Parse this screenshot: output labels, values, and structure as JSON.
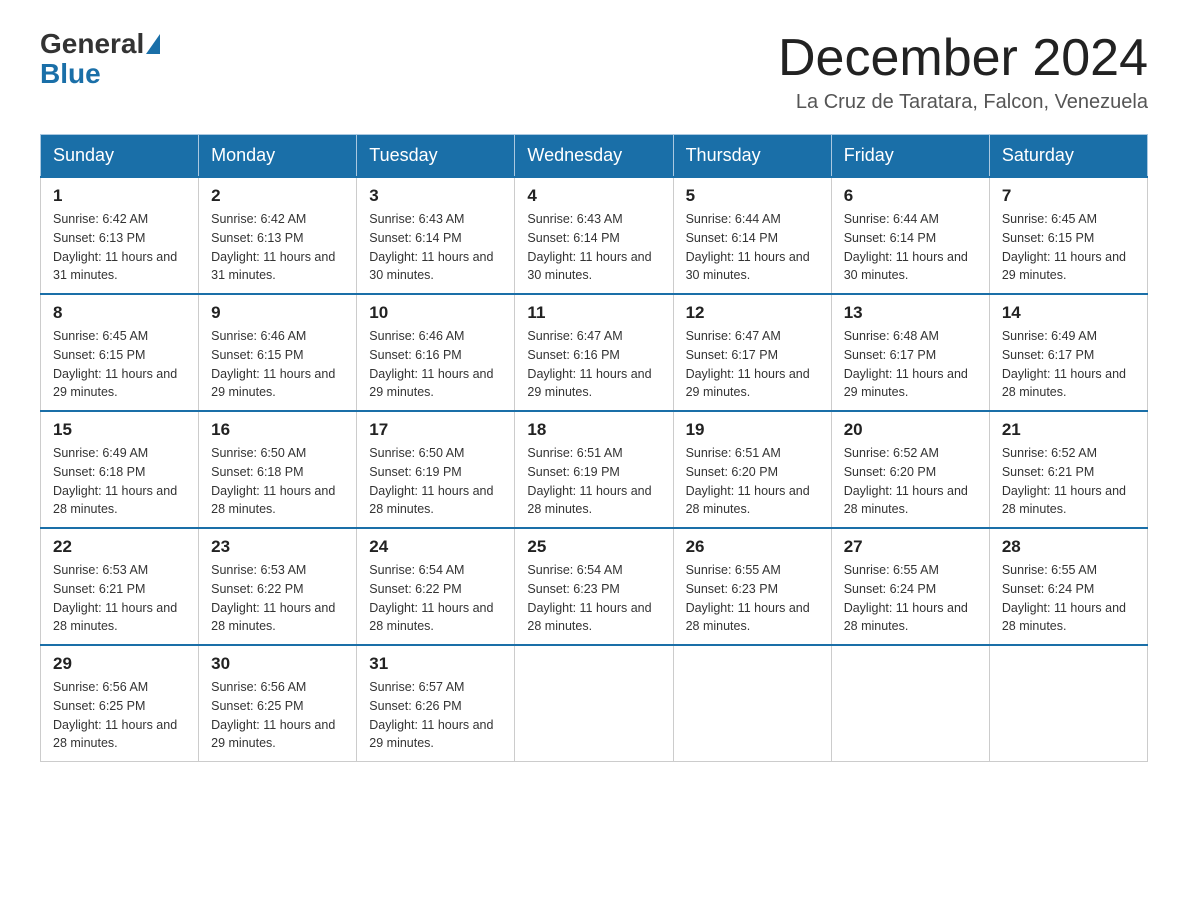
{
  "header": {
    "logo": {
      "general": "General",
      "blue": "Blue"
    },
    "title": "December 2024",
    "location": "La Cruz de Taratara, Falcon, Venezuela"
  },
  "weekdays": [
    "Sunday",
    "Monday",
    "Tuesday",
    "Wednesday",
    "Thursday",
    "Friday",
    "Saturday"
  ],
  "weeks": [
    [
      {
        "day": "1",
        "sunrise": "6:42 AM",
        "sunset": "6:13 PM",
        "daylight": "11 hours and 31 minutes."
      },
      {
        "day": "2",
        "sunrise": "6:42 AM",
        "sunset": "6:13 PM",
        "daylight": "11 hours and 31 minutes."
      },
      {
        "day": "3",
        "sunrise": "6:43 AM",
        "sunset": "6:14 PM",
        "daylight": "11 hours and 30 minutes."
      },
      {
        "day": "4",
        "sunrise": "6:43 AM",
        "sunset": "6:14 PM",
        "daylight": "11 hours and 30 minutes."
      },
      {
        "day": "5",
        "sunrise": "6:44 AM",
        "sunset": "6:14 PM",
        "daylight": "11 hours and 30 minutes."
      },
      {
        "day": "6",
        "sunrise": "6:44 AM",
        "sunset": "6:14 PM",
        "daylight": "11 hours and 30 minutes."
      },
      {
        "day": "7",
        "sunrise": "6:45 AM",
        "sunset": "6:15 PM",
        "daylight": "11 hours and 29 minutes."
      }
    ],
    [
      {
        "day": "8",
        "sunrise": "6:45 AM",
        "sunset": "6:15 PM",
        "daylight": "11 hours and 29 minutes."
      },
      {
        "day": "9",
        "sunrise": "6:46 AM",
        "sunset": "6:15 PM",
        "daylight": "11 hours and 29 minutes."
      },
      {
        "day": "10",
        "sunrise": "6:46 AM",
        "sunset": "6:16 PM",
        "daylight": "11 hours and 29 minutes."
      },
      {
        "day": "11",
        "sunrise": "6:47 AM",
        "sunset": "6:16 PM",
        "daylight": "11 hours and 29 minutes."
      },
      {
        "day": "12",
        "sunrise": "6:47 AM",
        "sunset": "6:17 PM",
        "daylight": "11 hours and 29 minutes."
      },
      {
        "day": "13",
        "sunrise": "6:48 AM",
        "sunset": "6:17 PM",
        "daylight": "11 hours and 29 minutes."
      },
      {
        "day": "14",
        "sunrise": "6:49 AM",
        "sunset": "6:17 PM",
        "daylight": "11 hours and 28 minutes."
      }
    ],
    [
      {
        "day": "15",
        "sunrise": "6:49 AM",
        "sunset": "6:18 PM",
        "daylight": "11 hours and 28 minutes."
      },
      {
        "day": "16",
        "sunrise": "6:50 AM",
        "sunset": "6:18 PM",
        "daylight": "11 hours and 28 minutes."
      },
      {
        "day": "17",
        "sunrise": "6:50 AM",
        "sunset": "6:19 PM",
        "daylight": "11 hours and 28 minutes."
      },
      {
        "day": "18",
        "sunrise": "6:51 AM",
        "sunset": "6:19 PM",
        "daylight": "11 hours and 28 minutes."
      },
      {
        "day": "19",
        "sunrise": "6:51 AM",
        "sunset": "6:20 PM",
        "daylight": "11 hours and 28 minutes."
      },
      {
        "day": "20",
        "sunrise": "6:52 AM",
        "sunset": "6:20 PM",
        "daylight": "11 hours and 28 minutes."
      },
      {
        "day": "21",
        "sunrise": "6:52 AM",
        "sunset": "6:21 PM",
        "daylight": "11 hours and 28 minutes."
      }
    ],
    [
      {
        "day": "22",
        "sunrise": "6:53 AM",
        "sunset": "6:21 PM",
        "daylight": "11 hours and 28 minutes."
      },
      {
        "day": "23",
        "sunrise": "6:53 AM",
        "sunset": "6:22 PM",
        "daylight": "11 hours and 28 minutes."
      },
      {
        "day": "24",
        "sunrise": "6:54 AM",
        "sunset": "6:22 PM",
        "daylight": "11 hours and 28 minutes."
      },
      {
        "day": "25",
        "sunrise": "6:54 AM",
        "sunset": "6:23 PM",
        "daylight": "11 hours and 28 minutes."
      },
      {
        "day": "26",
        "sunrise": "6:55 AM",
        "sunset": "6:23 PM",
        "daylight": "11 hours and 28 minutes."
      },
      {
        "day": "27",
        "sunrise": "6:55 AM",
        "sunset": "6:24 PM",
        "daylight": "11 hours and 28 minutes."
      },
      {
        "day": "28",
        "sunrise": "6:55 AM",
        "sunset": "6:24 PM",
        "daylight": "11 hours and 28 minutes."
      }
    ],
    [
      {
        "day": "29",
        "sunrise": "6:56 AM",
        "sunset": "6:25 PM",
        "daylight": "11 hours and 28 minutes."
      },
      {
        "day": "30",
        "sunrise": "6:56 AM",
        "sunset": "6:25 PM",
        "daylight": "11 hours and 29 minutes."
      },
      {
        "day": "31",
        "sunrise": "6:57 AM",
        "sunset": "6:26 PM",
        "daylight": "11 hours and 29 minutes."
      },
      null,
      null,
      null,
      null
    ]
  ],
  "labels": {
    "sunrise": "Sunrise:",
    "sunset": "Sunset:",
    "daylight": "Daylight:"
  }
}
